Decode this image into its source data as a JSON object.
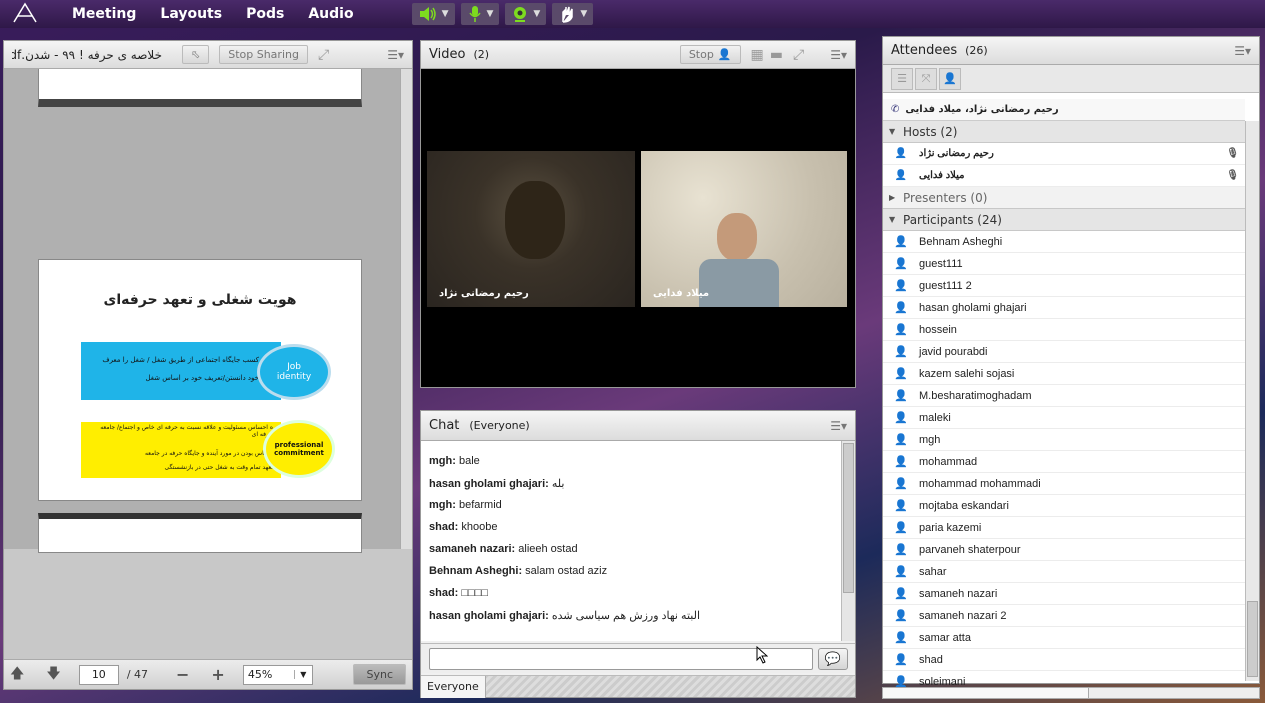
{
  "menubar": {
    "items": [
      "Meeting",
      "Layouts",
      "Pods",
      "Audio"
    ]
  },
  "share": {
    "title": "خلاصه ی حرفه ! ۹۹ - شدن.pdf",
    "stop_label": "Stop Sharing",
    "page_current": "10",
    "page_total": "/ 47",
    "zoom": "45%",
    "sync_label": "Sync",
    "slide": {
      "heading": "هویت شغلی و تعهد حرفه‌ای",
      "job_identity_label": "Job identity",
      "job_identity_text_1": "کسب جایگاه اجتماعی از طریق شغل / شغل را معرف",
      "job_identity_text_2": "خود دانستن/تعریف خود بر اساس شغل",
      "commitment_label": "professional commitment",
      "commitment_text_1": "ه احساس مسئولیت و علاقه نسبت به حرفه ای خاص و اجتماع/ جامعه حرفه ای",
      "commitment_text_2": "حساس بودن در مورد آینده و جایگاه حرفه در جامعه",
      "commitment_text_3": "تعهد تمام وقت به شغل حتی در بازنشستگی"
    }
  },
  "video": {
    "title": "Video",
    "count": "(2)",
    "stop_label": "Stop",
    "cams": [
      {
        "name": "رحیم رمضانی نژاد"
      },
      {
        "name": "میلاد فدایی"
      }
    ]
  },
  "chat": {
    "title": "Chat",
    "scope": "(Everyone)",
    "messages": [
      {
        "user": "mgh:",
        "text": "bale"
      },
      {
        "user": "hasan gholami ghajari:",
        "text": "بله"
      },
      {
        "user": "mgh:",
        "text": "befarmid"
      },
      {
        "user": "shad:",
        "text": "khoobe"
      },
      {
        "user": "samaneh nazari:",
        "text": "alieeh ostad"
      },
      {
        "user": "Behnam Asheghi:",
        "text": "salam ostad aziz"
      },
      {
        "user": "shad:",
        "text": "□□□□"
      },
      {
        "user": "hasan gholami ghajari:",
        "text": "البته نهاد ورزش هم سیاسی شده"
      }
    ],
    "tab_label": "Everyone"
  },
  "attendees": {
    "title": "Attendees",
    "count": "(26)",
    "speaking": "رحیم رمضانی نژاد، میلاد فدایی",
    "hosts_label": "Hosts (2)",
    "hosts": [
      "رحیم رمضانی نژاد",
      "میلاد فدایی"
    ],
    "presenters_label": "Presenters (0)",
    "participants_label": "Participants (24)",
    "participants": [
      "Behnam Asheghi",
      "guest111",
      "guest111 2",
      "hasan gholami ghajari",
      "hossein",
      "javid pourabdi",
      "kazem salehi sojasi",
      "M.besharatimoghadam",
      "maleki",
      "mgh",
      "mohammad",
      "mohammad mohammadi",
      "mojtaba eskandari",
      "paria kazemi",
      "parvaneh shaterpour",
      "sahar",
      "samaneh nazari",
      "samaneh nazari 2",
      "samar atta",
      "shad",
      "soleimani"
    ]
  },
  "colors": {
    "menubar": "#3b2058",
    "slide_blue": "#1fb4e8",
    "slide_yellow": "#ffee00",
    "mic_green": "#7ddc1f"
  }
}
